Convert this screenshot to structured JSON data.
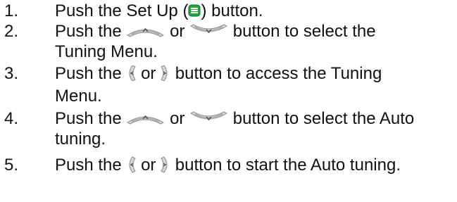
{
  "steps": [
    {
      "number": "1.",
      "lines": [
        {
          "a": "Push the Set Up (",
          "b": ") button.",
          "icon1": "set-up-button-icon"
        }
      ]
    },
    {
      "number": "2.",
      "lines": [
        {
          "a": "Push the ",
          "mid": " or ",
          "b": " button to select the",
          "icon1": "up-button-icon",
          "icon2": "down-button-icon"
        },
        {
          "text": "Tuning Menu."
        }
      ]
    },
    {
      "number": "3.",
      "lines": [
        {
          "a": "Push the ",
          "mid": " or ",
          "b": " button to access the Tuning",
          "icon1": "left-button-icon",
          "icon2": "right-button-icon"
        },
        {
          "text": "Menu."
        }
      ]
    },
    {
      "number": "4.",
      "lines": [
        {
          "a": "Push the ",
          "mid": " or ",
          "b": " button to select the Auto",
          "icon1": "up-button-icon",
          "icon2": "down-button-icon"
        },
        {
          "text": "tuning."
        }
      ]
    },
    {
      "number": "5.",
      "lines": [
        {
          "a": "Push the ",
          "mid": " or ",
          "b": " button to start the Auto tuning.",
          "icon1": "left-button-icon",
          "icon2": "right-button-icon"
        }
      ]
    }
  ]
}
